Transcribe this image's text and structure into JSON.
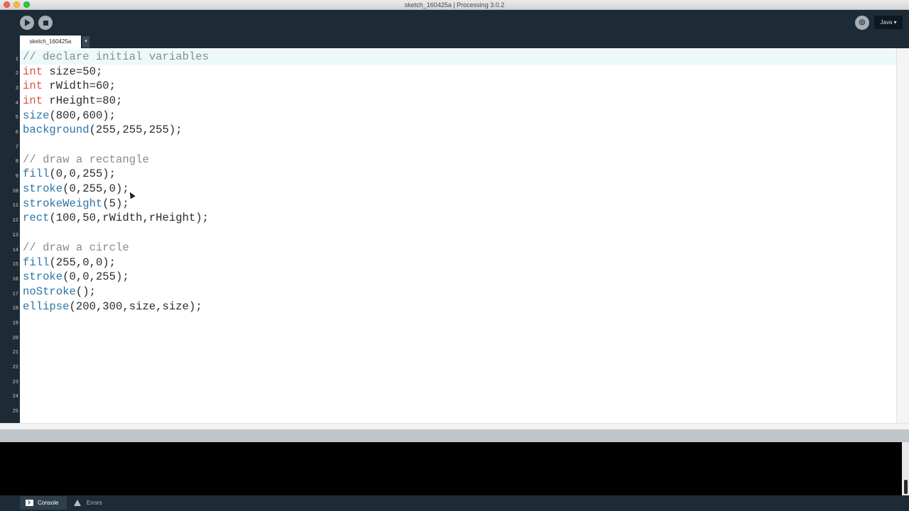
{
  "window": {
    "title": "sketch_160425a | Processing 3.0.2"
  },
  "toolbar": {
    "run_icon": "play-icon",
    "stop_icon": "stop-icon",
    "debug_icon": "debugger-icon",
    "mode_label": "Java ▾"
  },
  "tabs": {
    "active_tab": "sketch_160425a",
    "menu_arrow": "▾"
  },
  "editor": {
    "current_line": 1,
    "lines": [
      "// declare initial variables",
      "int size=50;",
      "int rWidth=60;",
      "int rHeight=80;",
      "size(800,600);",
      "background(255,255,255);",
      "",
      "// draw a rectangle",
      "fill(0,0,255);",
      "stroke(0,255,0);",
      "strokeWeight(5);",
      "rect(100,50,rWidth,rHeight);",
      "",
      "// draw a circle",
      "fill(255,0,0);",
      "stroke(0,0,255);",
      "noStroke();",
      "ellipse(200,300,size,size);",
      "",
      "",
      "",
      "",
      "",
      "",
      ""
    ],
    "line_numbers": [
      "1",
      "2",
      "3",
      "4",
      "5",
      "6",
      "7",
      "8",
      "9",
      "10",
      "11",
      "12",
      "13",
      "14",
      "15",
      "16",
      "17",
      "18",
      "19",
      "20",
      "21",
      "22",
      "23",
      "24",
      "25"
    ],
    "syntax_colors": {
      "keyword": "#d7553f",
      "function": "#2b74a8",
      "comment": "#8a8a8a",
      "default": "#2a2a2a"
    }
  },
  "bottom_tabs": {
    "console_label": "Console",
    "errors_label": "Errors"
  },
  "colors": {
    "chrome": "#1c2b36",
    "editor_bg": "#ffffff",
    "console_bg": "#000000"
  }
}
